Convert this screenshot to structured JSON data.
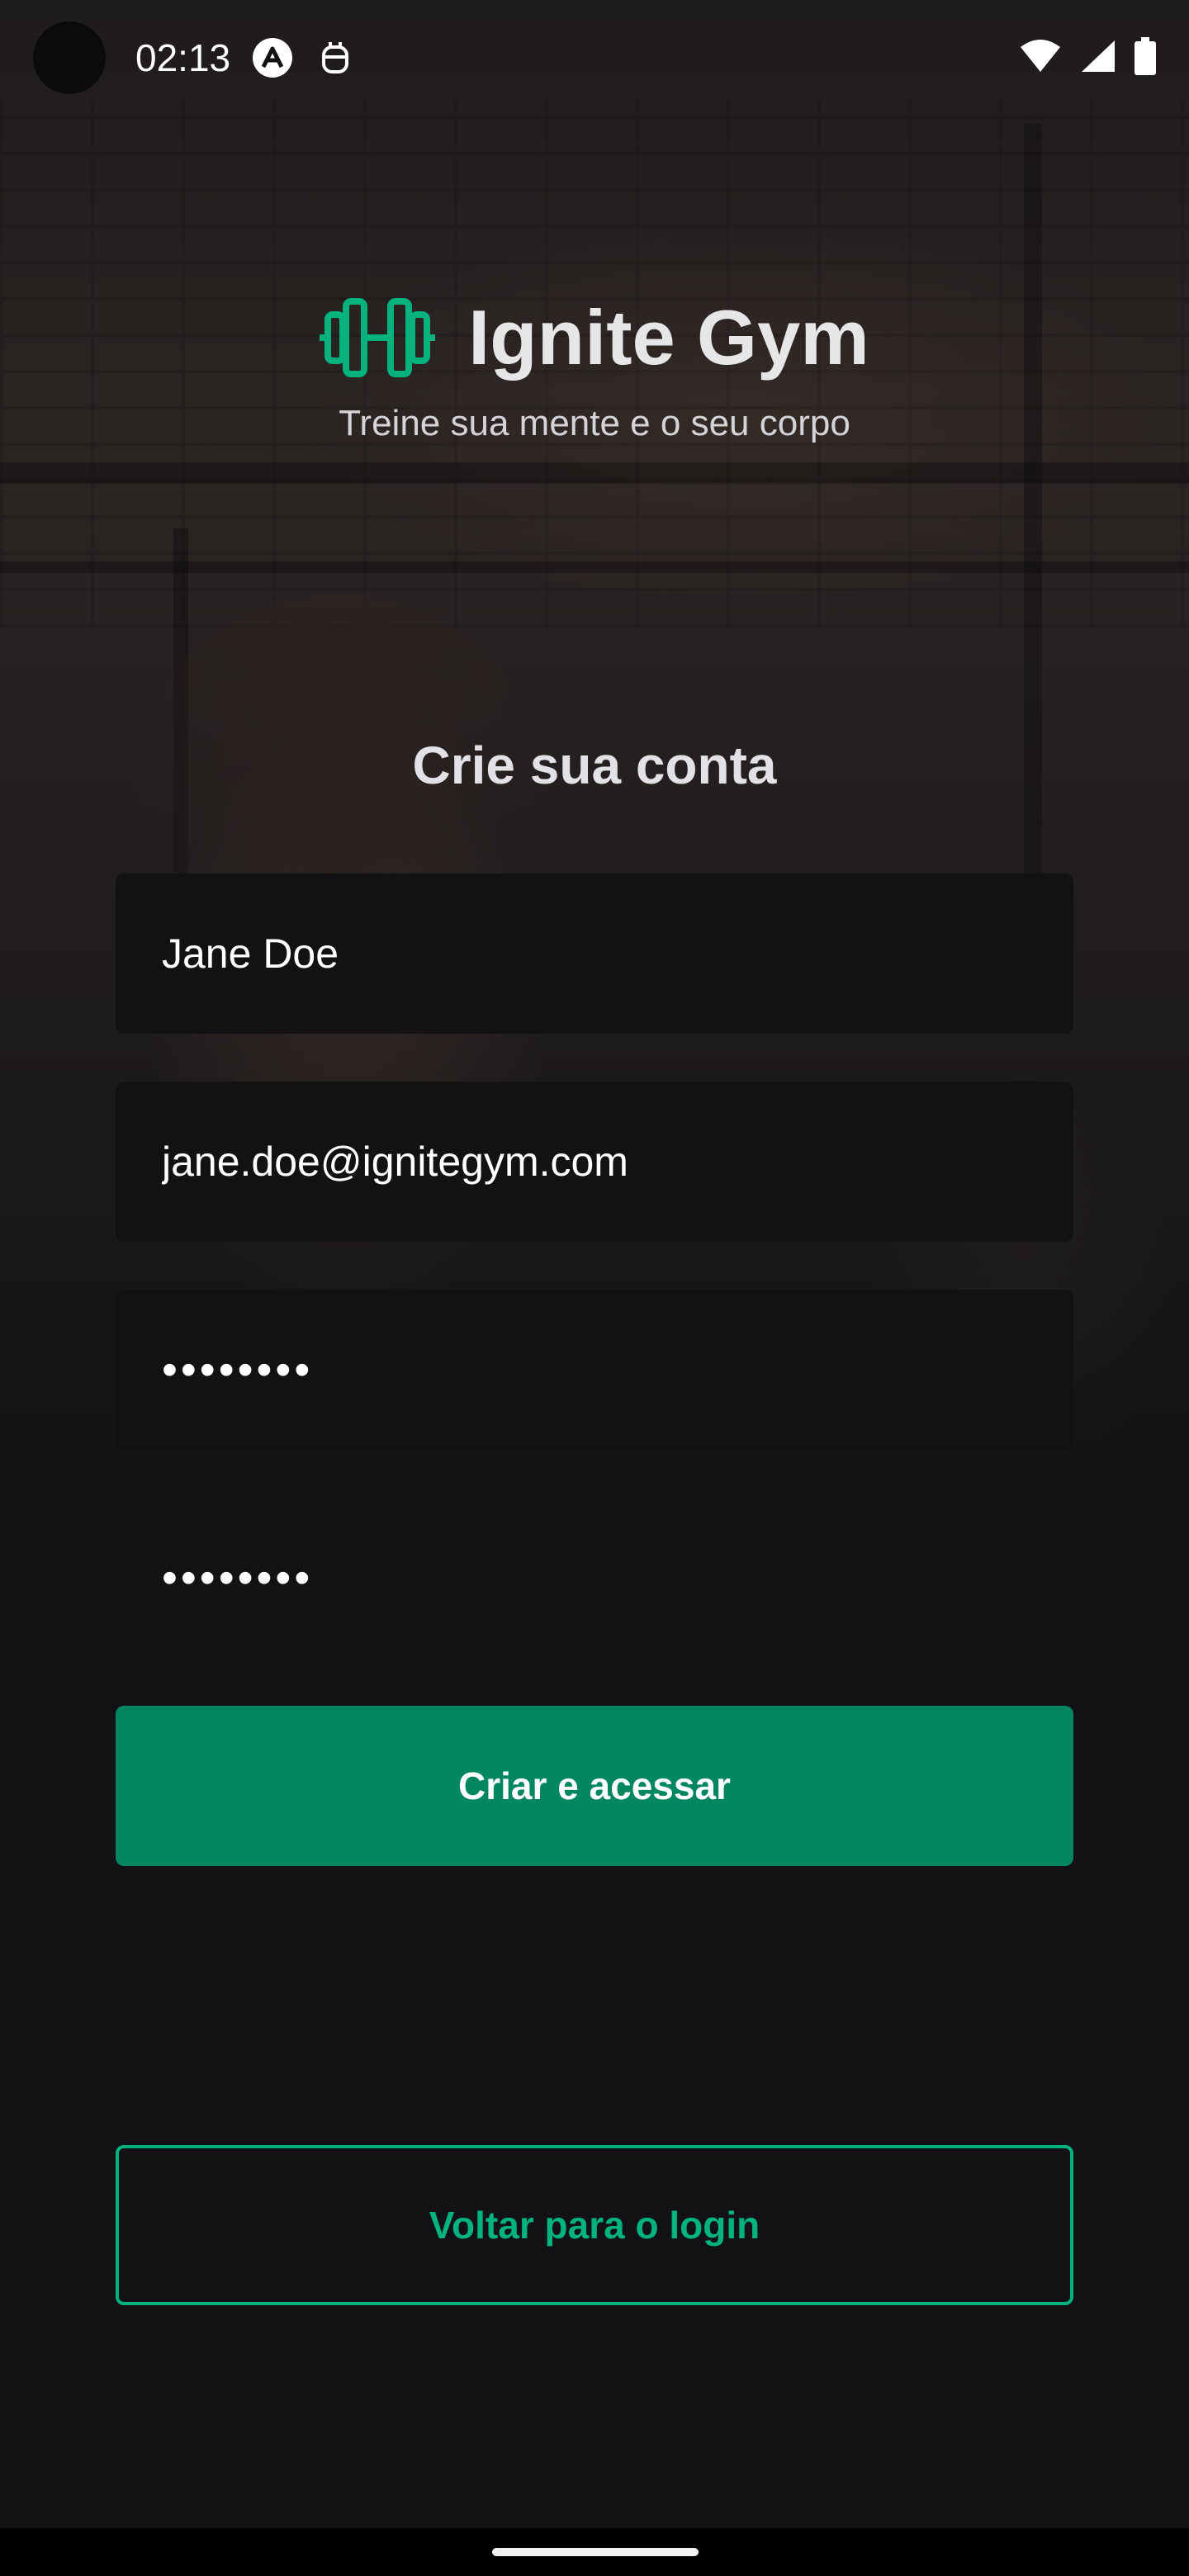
{
  "status_bar": {
    "time": "02:13",
    "icons": [
      "app-notification-icon",
      "robot-notification-icon",
      "wifi-icon",
      "signal-icon",
      "battery-icon"
    ]
  },
  "brand": {
    "name": "Ignite Gym",
    "tagline": "Treine sua mente e o seu corpo",
    "accent_color": "#00B37E",
    "logo_icon": "dumbbell-icon"
  },
  "form": {
    "title": "Crie sua conta",
    "name_value": "Jane Doe",
    "email_value": "jane.doe@ignitegym.com",
    "password_value": "password",
    "confirm_password_value": "password"
  },
  "actions": {
    "submit_label": "Criar e acessar",
    "submit_color": "#00875F",
    "back_label": "Voltar para o login"
  }
}
